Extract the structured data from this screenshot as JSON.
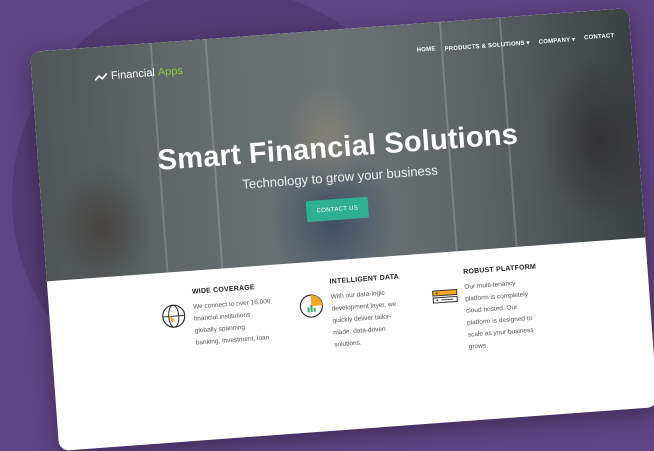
{
  "site": {
    "logo_left": "Financial",
    "logo_right": "Apps",
    "accent_color": "#8fc63f",
    "cta_color": "#2fb094"
  },
  "nav": {
    "items": [
      "HOME",
      "PRODUCTS & SOLUTIONS ▾",
      "COMPANY ▾",
      "CONTACT"
    ]
  },
  "hero": {
    "title": "Smart Financial Solutions",
    "subtitle": "Technology to grow your business",
    "cta": "CONTACT US"
  },
  "features": [
    {
      "title": "WIDE COVERAGE",
      "icon": "globe-icon",
      "lines": [
        "We connect to over 16,000",
        "financial institutions",
        "globally spanning",
        "banking, investment, loan"
      ]
    },
    {
      "title": "INTELLIGENT DATA",
      "icon": "pie-chart-icon",
      "lines": [
        "With our data-logic",
        "development layer, we",
        "quickly deliver tailor-",
        "made, data-driven",
        "solutions."
      ]
    },
    {
      "title": "ROBUST PLATFORM",
      "icon": "server-icon",
      "lines": [
        "Our multi-tenancy",
        "platform is completely",
        "cloud hosted. Our",
        "platform is designed to",
        "scale as your business",
        "grows."
      ]
    }
  ]
}
